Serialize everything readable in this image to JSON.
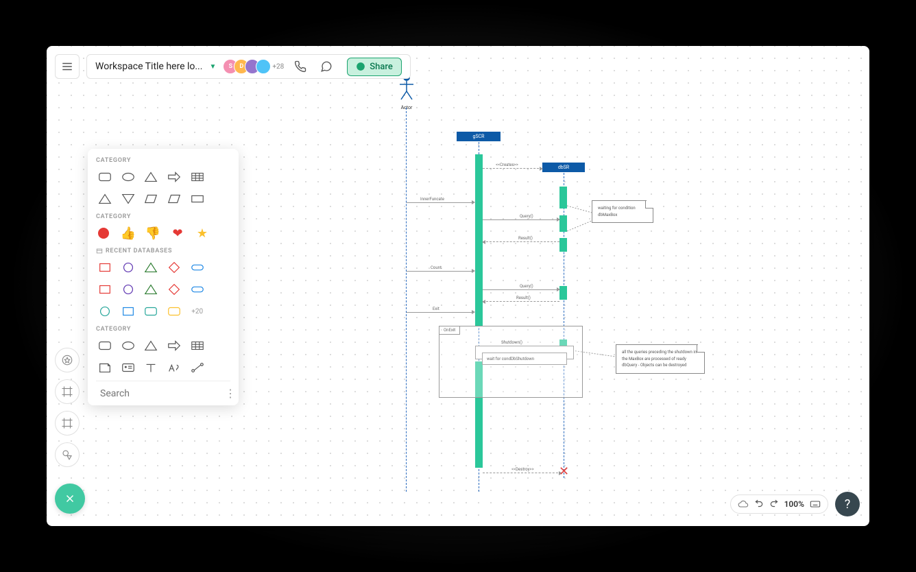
{
  "header": {
    "workspace_title": "Workspace Title here lo...",
    "avatar_overflow": "+28",
    "share_label": "Share"
  },
  "shape_panel": {
    "cat1_label": "CATEGORY",
    "cat2_label": "CATEGORY",
    "cat3_label": "RECENT DATABASES",
    "cat4_label": "CATEGORY",
    "more_count": "+20",
    "search_placeholder": "Search"
  },
  "bottom": {
    "zoom": "100%"
  },
  "diagram": {
    "actor_label": "Actor",
    "obj1_label": "gSCR",
    "obj2_label": "dbSR",
    "note1": "waiting for condition dbMaxBox",
    "note2": "all the queries preceding the shutdown in the MaxBox are processed of ready dbQuery - Objects can be destroyed",
    "frag_label": "OnExit",
    "msg_innerexist": "InnerFuncate",
    "msg_ocreate": "<<Creates>>",
    "msg_query": "Query()",
    "msg_result": "Result()",
    "msg_count": "Count",
    "msg_query2": "Query()",
    "msg_result2": "Result()",
    "msg_exit": "Exit",
    "msg_shutdown": "Shutdown()",
    "msg_wait": "wait   for   condDbShutdown",
    "msg_destroy": "<<Destroy>>"
  }
}
